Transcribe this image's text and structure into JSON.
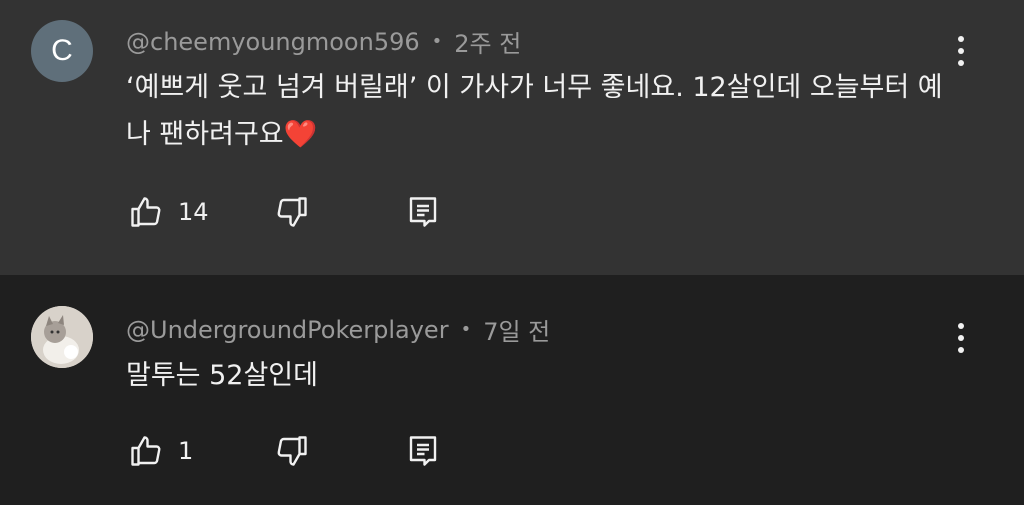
{
  "comments": [
    {
      "avatar_letter": "C",
      "author": "@cheemyoungmoon596",
      "time": "2주 전",
      "text": "‘예쁘게 웃고 넘겨 버릴래’ 이 가사가 너무 좋네요. 12살인데 오늘부터 예나 팬하려구요",
      "emoji": "❤️",
      "likes": "14"
    },
    {
      "author": "@UndergroundPokerplayer",
      "time": "7일 전",
      "text": "말투는 52살인데",
      "likes": "1"
    }
  ],
  "separator": "•",
  "icons": [
    "thumb-up-icon",
    "thumb-down-icon",
    "reply-icon",
    "more-vert-icon"
  ]
}
